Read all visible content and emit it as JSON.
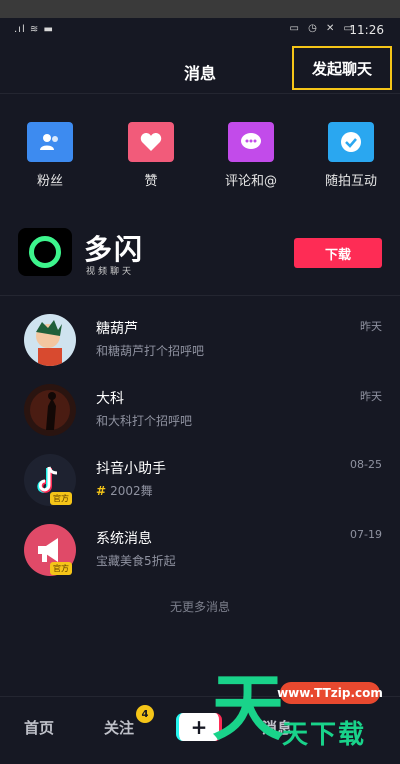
{
  "status_bar": {
    "left_icons": ".ıl ≋ ▬",
    "right_icons": "▭ ◷ ✕ ▭",
    "time": "11:26"
  },
  "header": {
    "title": "消息",
    "start_chat": "发起聊天"
  },
  "quick_actions": [
    {
      "label": "粉丝",
      "icon": "fans-icon",
      "color": "#3d8bf0"
    },
    {
      "label": "赞",
      "icon": "heart-icon",
      "color": "#f25b7a"
    },
    {
      "label": "评论和@",
      "icon": "comment-icon",
      "color": "#c24bea"
    },
    {
      "label": "随拍互动",
      "icon": "check-icon",
      "color": "#2aa7f0"
    }
  ],
  "promo": {
    "name": "多闪",
    "subtitle": "视频聊天",
    "download": "下载"
  },
  "messages": [
    {
      "name": "糖葫芦",
      "preview": "和糖葫芦打个招呼吧",
      "time": "昨天"
    },
    {
      "name": "大科",
      "preview": "和大科打个招呼吧",
      "time": "昨天"
    },
    {
      "name": "抖音小助手",
      "preview": "2002舞",
      "time": "08-25",
      "badge": "官方"
    },
    {
      "name": "系统消息",
      "preview": "宝藏美食5折起",
      "time": "07-19",
      "badge": "官方"
    }
  ],
  "no_more": "无更多消息",
  "tabbar": {
    "home": "首页",
    "follow": "关注",
    "follow_badge": "4",
    "plus": "+",
    "message": "消息"
  },
  "watermark": {
    "big": "天",
    "url": "www.TTzip.com",
    "text": "天下载"
  }
}
